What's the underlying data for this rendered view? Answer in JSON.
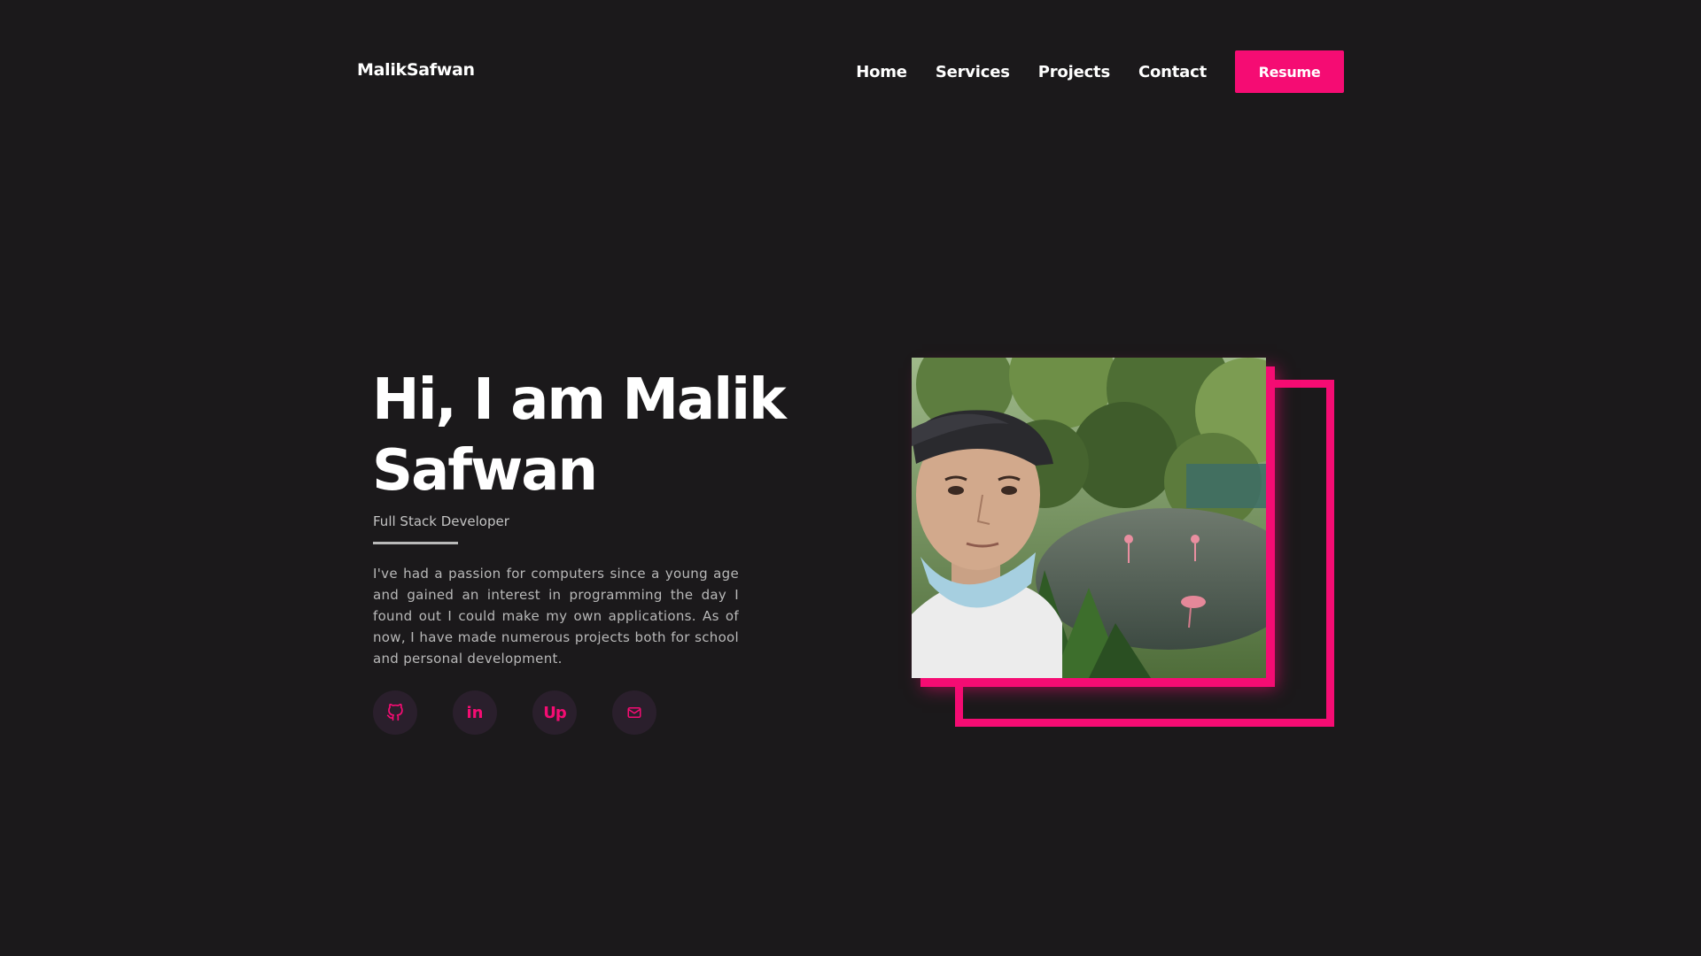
{
  "nav": {
    "logo": "MalikSafwan",
    "items": [
      {
        "label": "Home"
      },
      {
        "label": "Services"
      },
      {
        "label": "Projects"
      },
      {
        "label": "Contact"
      }
    ],
    "resume_label": "Resume"
  },
  "hero": {
    "title": "Hi, I am Malik Safwan",
    "role": "Full Stack Developer",
    "bio": "I've had a passion for computers since a young age and gained an interest in programming the day I found out I could make my own applications. As of now, I have made numerous projects both for school and personal development.",
    "socials": [
      {
        "icon": "github-icon"
      },
      {
        "icon": "linkedin-icon",
        "text": "in"
      },
      {
        "icon": "upwork-icon",
        "text": "Up"
      },
      {
        "icon": "mail-icon"
      }
    ]
  },
  "colors": {
    "background": "#1b191b",
    "accent": "#f50c73",
    "text": "#ffffff",
    "muted": "#b8b8b8",
    "social_bg": "#2a1f2c"
  }
}
